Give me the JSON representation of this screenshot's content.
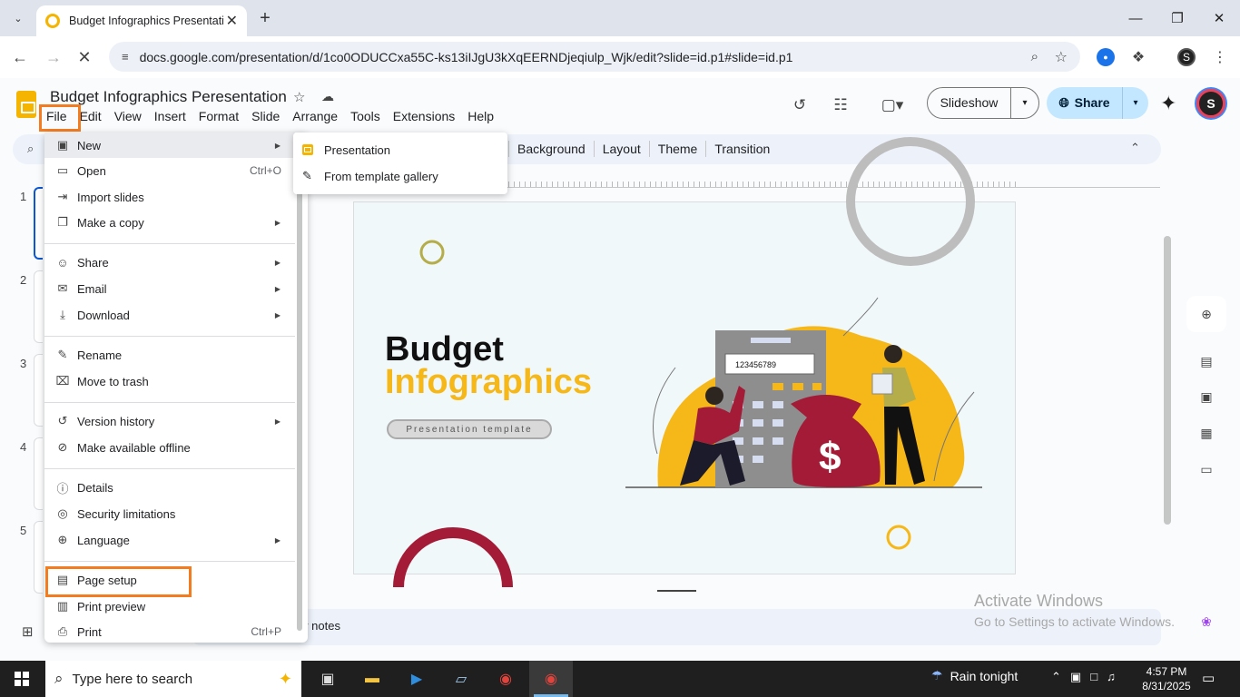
{
  "browser": {
    "tab_title": "Budget Infographics Presentation - Google Slides",
    "url": "docs.google.com/presentation/d/1co0ODUCCxa55C-ks13iIJgU3kXqEERNDjeqiulp_Wjk/edit?slide=id.p1#slide=id.p1",
    "icons": [
      "tab-list-icon",
      "close-icon",
      "plus-icon",
      "minimize-icon",
      "maximize-icon",
      "back-icon",
      "forward-icon",
      "reload-icon",
      "site-settings-icon",
      "zoom-icon",
      "bookmark-star-icon",
      "extension-icon",
      "menu-kebab-icon"
    ]
  },
  "docs": {
    "title": "Budget Infographics Peresentation",
    "menus": [
      "File",
      "Edit",
      "View",
      "Insert",
      "Format",
      "Slide",
      "Arrange",
      "Tools",
      "Extensions",
      "Help"
    ],
    "slideshow_label": "Slideshow",
    "share_label": "Share",
    "avatar_initial": "S"
  },
  "slide_toolbar": {
    "items": [
      "Background",
      "Layout",
      "Theme",
      "Transition"
    ]
  },
  "filmstrip": {
    "slide_numbers": [
      "1",
      "2",
      "3",
      "4",
      "5"
    ]
  },
  "slide": {
    "title_line1": "Budget",
    "title_line2": "Infographics",
    "pill_text": "Presentation template",
    "calculator_display": "123456789",
    "money_symbol": "$",
    "colors": {
      "yellow": "#f6b719",
      "maroon": "#a31b36",
      "olive": "#b5ad4a"
    }
  },
  "speaker_notes_label": "er notes",
  "watermark": {
    "line1": "Activate Windows",
    "line2": "Go to Settings to activate Windows."
  },
  "file_menu": {
    "items": [
      {
        "label": "New",
        "icon": "new-doc-icon",
        "submenu": true
      },
      {
        "label": "Open",
        "icon": "folder-icon",
        "shortcut": "Ctrl+O"
      },
      {
        "label": "Import slides",
        "icon": "import-icon"
      },
      {
        "label": "Make a copy",
        "icon": "copy-icon",
        "submenu": true
      },
      {
        "label": "Share",
        "icon": "person-add-icon",
        "submenu": true
      },
      {
        "label": "Email",
        "icon": "email-icon",
        "submenu": true
      },
      {
        "label": "Download",
        "icon": "download-icon",
        "submenu": true
      },
      {
        "label": "Rename",
        "icon": "pencil-icon"
      },
      {
        "label": "Move to trash",
        "icon": "trash-icon"
      },
      {
        "label": "Version history",
        "icon": "history-icon",
        "submenu": true
      },
      {
        "label": "Make available offline",
        "icon": "offline-icon"
      },
      {
        "label": "Details",
        "icon": "info-icon"
      },
      {
        "label": "Security limitations",
        "icon": "shield-icon"
      },
      {
        "label": "Language",
        "icon": "globe-icon",
        "submenu": true
      },
      {
        "label": "Page setup",
        "icon": "page-icon"
      },
      {
        "label": "Print preview",
        "icon": "preview-icon"
      },
      {
        "label": "Print",
        "icon": "printer-icon",
        "shortcut": "Ctrl+P"
      }
    ]
  },
  "new_submenu": {
    "items": [
      "Presentation",
      "From template gallery"
    ]
  },
  "taskbar": {
    "search_placeholder": "Type here to search",
    "weather": "Rain tonight",
    "time": "4:57 PM",
    "date": "8/31/2025"
  }
}
